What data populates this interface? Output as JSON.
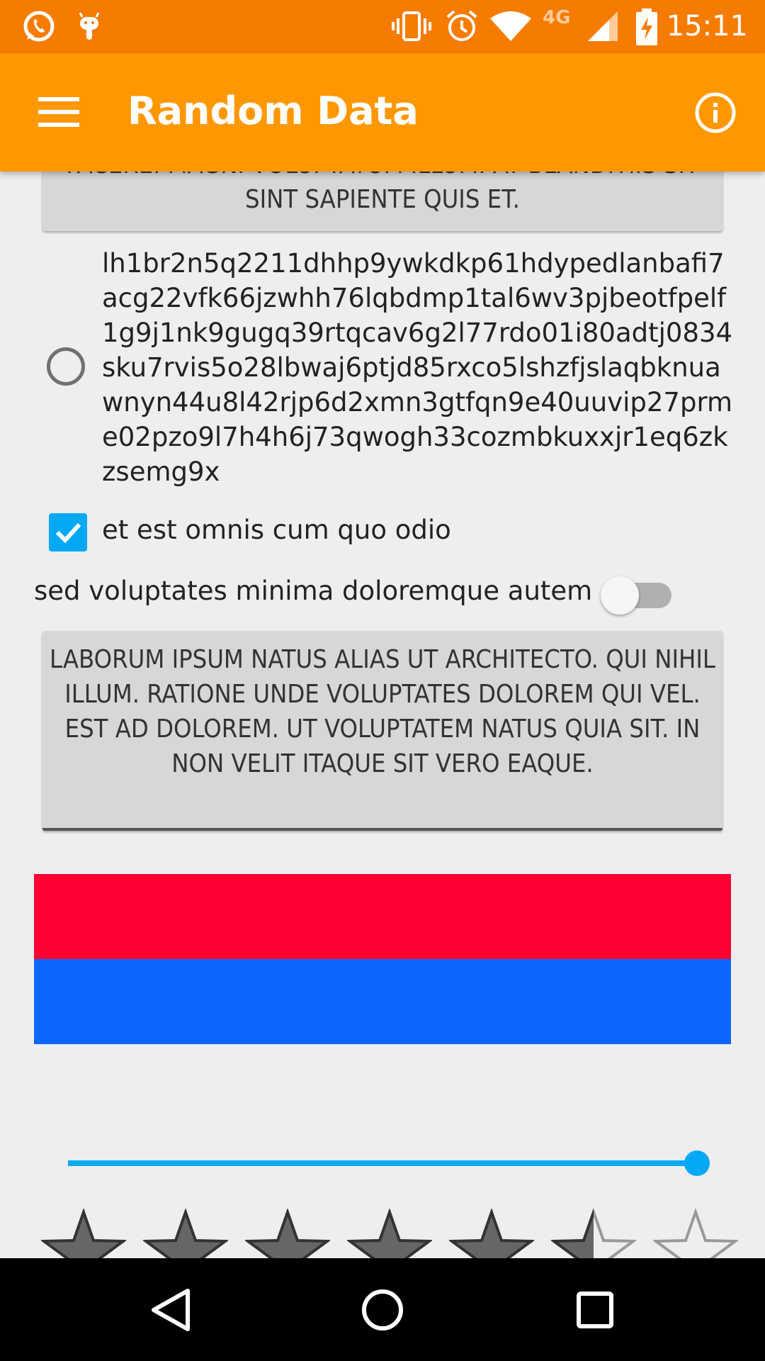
{
  "status_bar": {
    "time": "15:11",
    "network": "4G",
    "icons": [
      "whatsapp-icon",
      "android-icon",
      "vibrate-icon",
      "alarm-icon",
      "wifi-icon",
      "signal-icon",
      "battery-charging-icon"
    ]
  },
  "app_bar": {
    "title": "Random Data",
    "menu_icon": "hamburger-menu-icon",
    "info_icon": "info-icon"
  },
  "top_button": {
    "label": "Facere. Magni voluptatum illum. At blanditiis sit sint sapiente quis et."
  },
  "radio": {
    "label": "lh1br2n5q2211dhhp9ywkdkp61hdypedlanbafi7acg22vfk66jzwhh76lqbdmp1tal6wv3pjbeotfpelf1g9j1nk9gugq39rtqcav6g2l77rdo01i80adtj0834sku7rvis5o28lbwaj6ptjd85rxco5lshzfjslaqbknuawnyn44u8l42rjp6d2xmn3gtfqn9e40uuvip27prme02pzo9l7h4h6j73qwogh33cozmbkuxxjr1eq6zkzsemg9x",
    "checked": false
  },
  "checkbox": {
    "label": "et est omnis cum quo odio",
    "checked": true
  },
  "switch": {
    "label": "sed voluptates minima doloremque autem",
    "on": false
  },
  "main_button": {
    "label": "Laborum ipsum natus alias ut architecto. Qui nihil illum. Ratione unde voluptates dolorem qui vel. Est ad dolorem. Ut voluptatem natus quia sit. In non velit itaque sit vero eaque."
  },
  "color_blocks": {
    "top": "#ff0033",
    "bottom": "#0d66ff"
  },
  "seek_bar": {
    "value_fraction": 1.0,
    "color": "#03a9f4"
  },
  "rating": {
    "stars_total": 7,
    "stars_filled": 5.5
  },
  "nav_bar": {
    "buttons": [
      "back-icon",
      "home-icon",
      "recents-icon"
    ]
  }
}
